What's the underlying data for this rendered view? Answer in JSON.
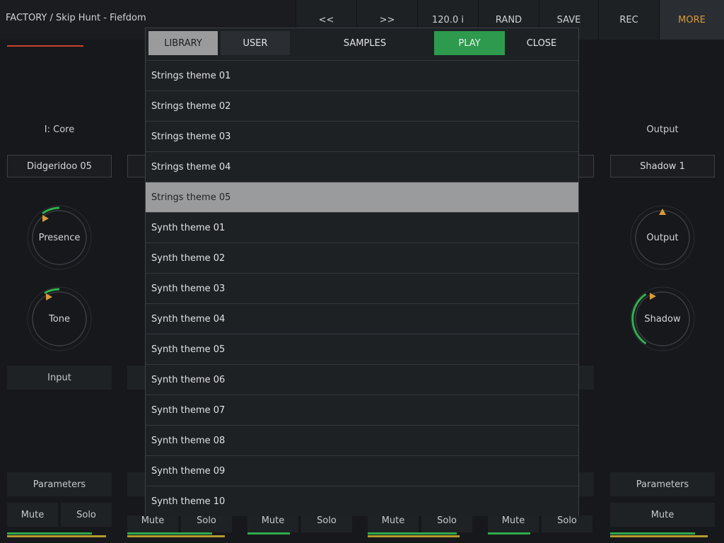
{
  "header": {
    "preset_title": "FACTORY / Skip Hunt - Fiefdom",
    "buttons": [
      {
        "label": "<<"
      },
      {
        "label": ">>"
      },
      {
        "label": "120.0 i"
      },
      {
        "label": "RAND"
      },
      {
        "label": "SAVE"
      },
      {
        "label": "REC"
      },
      {
        "label": "MORE"
      }
    ]
  },
  "left_panel": {
    "title": "I: Core",
    "preset_box": "Didgeridoo 05",
    "knob1_label": "Presence",
    "knob1_level": 0.12,
    "knob2_label": "Tone",
    "knob2_level": 0.1,
    "input_button": "Input",
    "parameters_button": "Parameters",
    "mute_button": "Mute",
    "solo_button": "Solo"
  },
  "right_panel": {
    "title": "Output",
    "preset_box": "Shadow 1",
    "knob1_label": "Output",
    "knob1_level": 0.0,
    "knob2_label": "Shadow",
    "knob2_level": 0.3,
    "parameters_button": "Parameters",
    "mute_button": "Mute"
  },
  "behind_labels": {
    "mute": "Mute",
    "solo": "Solo"
  },
  "browser": {
    "tabs": {
      "library": "LIBRARY",
      "user": "USER",
      "samples": "SAMPLES",
      "play": "PLAY",
      "close": "CLOSE"
    },
    "selected_index": 4,
    "items": [
      "Strings theme 01",
      "Strings theme 02",
      "Strings theme 03",
      "Strings theme 04",
      "Strings theme 05",
      "Synth theme 01",
      "Synth theme 02",
      "Synth theme 03",
      "Synth theme 04",
      "Synth theme 05",
      "Synth theme 06",
      "Synth theme 07",
      "Synth theme 08",
      "Synth theme 09",
      "Synth theme 10"
    ]
  },
  "colors": {
    "accent_green": "#2d9a4e",
    "accent_orange": "#d89a3a",
    "selected_row": "#9a9b9d"
  }
}
